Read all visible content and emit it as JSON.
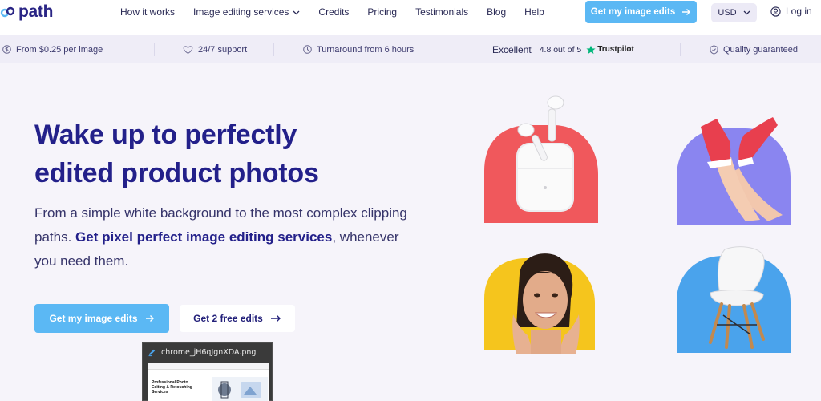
{
  "brand": {
    "name": "path"
  },
  "nav": {
    "links": [
      "How it works",
      "Image editing services",
      "Credits",
      "Pricing",
      "Testimonials",
      "Blog",
      "Help"
    ],
    "cta": "Get my image edits",
    "currency": "USD",
    "login": "Log in"
  },
  "benefits": {
    "price": "From $0.25 per image",
    "support": "24/7 support",
    "turnaround": "Turnaround from 6 hours",
    "trustpilot_label": "Excellent",
    "trustpilot_score": "4.8 out of 5",
    "trustpilot_brand": "Trustpilot",
    "quality": "Quality guaranteed"
  },
  "hero": {
    "title_line1": "Wake up to perfectly",
    "title_line2": "edited product photos",
    "subtitle_start": "From a simple white background to the most complex clipping paths. ",
    "subtitle_bold": "Get pixel perfect image editing services",
    "subtitle_end": ", whenever you need them.",
    "primary_button": "Get my image edits",
    "secondary_button": "Get 2 free edits"
  },
  "thumbnail": {
    "filename": "chrome_jH6qJgnXDA.png",
    "preview_text": "Professional Photo Editing & Retouching Services"
  },
  "colors": {
    "accent": "#5bb8f4",
    "brand_navy": "#23208a",
    "blob_red": "#f0585c",
    "blob_purple": "#8a85f0",
    "blob_yellow": "#f5c51d",
    "blob_blue": "#4aa3ec",
    "trustpilot_green": "#00b67a"
  }
}
